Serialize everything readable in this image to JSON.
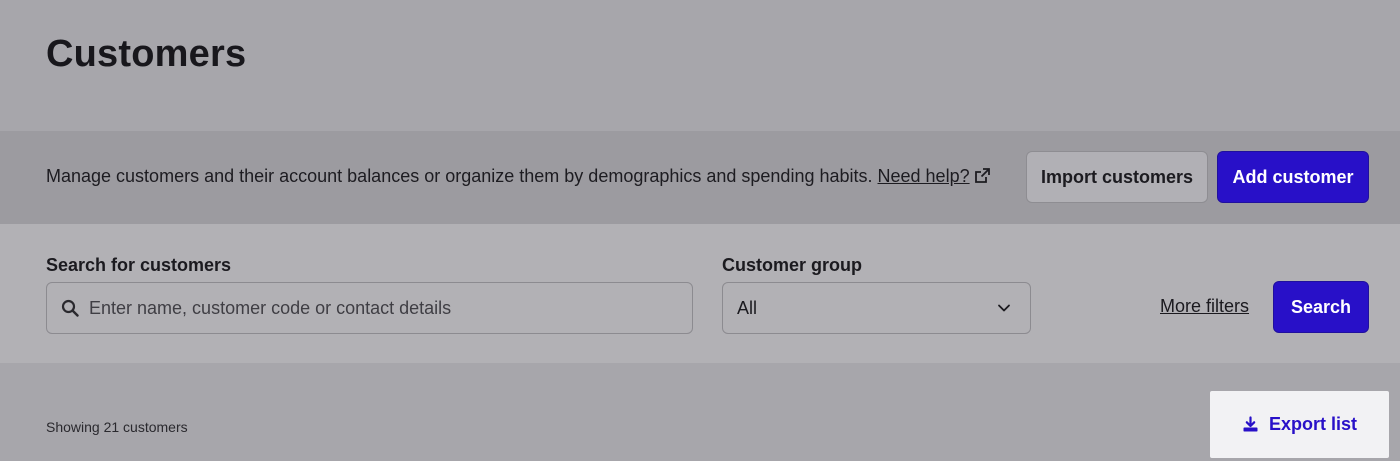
{
  "page": {
    "title": "Customers"
  },
  "info": {
    "description": "Manage customers and their account balances or organize them by demographics and spending habits.",
    "help_link": "Need help?"
  },
  "actions": {
    "import_label": "Import customers",
    "add_label": "Add customer"
  },
  "filters": {
    "search_label": "Search for customers",
    "search_placeholder": "Enter name, customer code or contact details",
    "search_value": "",
    "group_label": "Customer group",
    "group_selected": "All",
    "more_filters": "More filters",
    "search_button": "Search"
  },
  "results": {
    "showing_text": "Showing 21 customers",
    "export_label": "Export list"
  },
  "colors": {
    "primary": "#2810c8",
    "overlay_bg": "#a7a6ab",
    "export_panel_bg": "#f2f2f4"
  },
  "icons": {
    "help": "external-link-icon",
    "search": "search-icon",
    "select": "chevron-down-icon",
    "export": "download-icon"
  }
}
